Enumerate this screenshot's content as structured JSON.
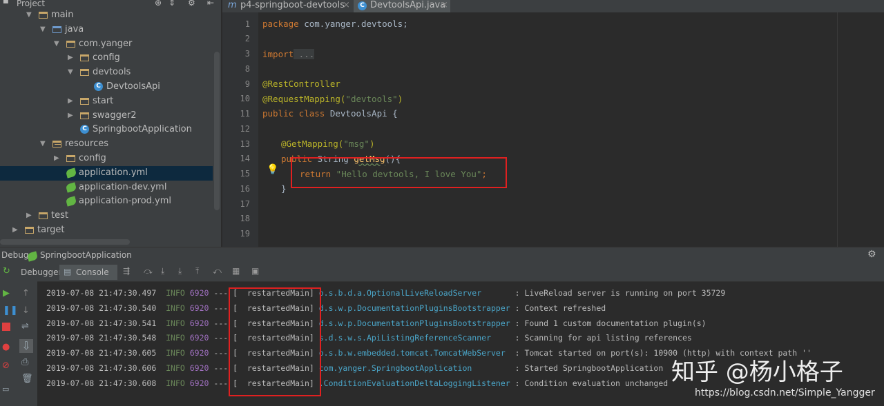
{
  "project_panel": {
    "header": "Project",
    "tree": [
      {
        "label": "main",
        "kind": "folder",
        "arrow": "▼"
      },
      {
        "label": "java",
        "kind": "src",
        "arrow": "▼"
      },
      {
        "label": "com.yanger",
        "kind": "folder",
        "arrow": "▼"
      },
      {
        "label": "config",
        "kind": "folder",
        "arrow": "▶"
      },
      {
        "label": "devtools",
        "kind": "folder",
        "arrow": "▼"
      },
      {
        "label": "DevtoolsApi",
        "kind": "class",
        "arrow": ""
      },
      {
        "label": "start",
        "kind": "folder",
        "arrow": "▶"
      },
      {
        "label": "swagger2",
        "kind": "folder",
        "arrow": "▶"
      },
      {
        "label": "SpringbootApplication",
        "kind": "class",
        "arrow": ""
      },
      {
        "label": "resources",
        "kind": "res",
        "arrow": "▼"
      },
      {
        "label": "config",
        "kind": "folder",
        "arrow": "▶"
      },
      {
        "label": "application.yml",
        "kind": "yml",
        "arrow": "",
        "selected": true
      },
      {
        "label": "application-dev.yml",
        "kind": "yml",
        "arrow": ""
      },
      {
        "label": "application-prod.yml",
        "kind": "yml",
        "arrow": ""
      },
      {
        "label": "test",
        "kind": "folder",
        "arrow": "▶"
      },
      {
        "label": "target",
        "kind": "folder",
        "arrow": "▶"
      }
    ]
  },
  "editor": {
    "tabs": [
      {
        "label": "p4-springboot-devtools",
        "icon": "m"
      },
      {
        "label": "DevtoolsApi.java",
        "icon": "C",
        "active": true
      }
    ],
    "line_numbers": [
      "1",
      "2",
      "3",
      "8",
      "9",
      "10",
      "11",
      "12",
      "13",
      "14",
      "15",
      "16",
      "17",
      "18",
      "19"
    ],
    "code": {
      "l1_kw": "package",
      "l1_rest": " com.yanger.devtools;",
      "l3_kw": "import",
      "l3_rest": " ...",
      "l9": "@RestController",
      "l10_an": "@RequestMapping(",
      "l10_st": "\"devtools\"",
      "l10_end": ")",
      "l11_kw": "public class",
      "l11_rest": " DevtoolsApi {",
      "l13_an": "@GetMapping(",
      "l13_st": "\"msg\"",
      "l13_end": ")",
      "l14_kw": "public",
      "l14_rest": " String ",
      "l14_mt": "getMsg",
      "l14_end": "(){",
      "l15_kw": "return",
      "l15_st": " \"Hello devtools, I love You\"",
      "l15_end": ";",
      "l16": "}"
    }
  },
  "debug": {
    "title": "Debug",
    "config": "SpringbootApplication",
    "tabs": [
      "Debugger",
      "Console"
    ],
    "log": [
      {
        "ts": "2019-07-08 21:47:30.497",
        "level": "INFO",
        "pid": "6920",
        "sep": "---",
        "thread": "[  restartedMain]",
        "logger": "o.s.b.d.a.OptionalLiveReloadServer      ",
        "msg": ": LiveReload server is running on port 35729"
      },
      {
        "ts": "2019-07-08 21:47:30.540",
        "level": "INFO",
        "pid": "6920",
        "sep": "---",
        "thread": "[  restartedMain]",
        "logger": "d.s.w.p.DocumentationPluginsBootstrapper",
        "msg": ": Context refreshed"
      },
      {
        "ts": "2019-07-08 21:47:30.541",
        "level": "INFO",
        "pid": "6920",
        "sep": "---",
        "thread": "[  restartedMain]",
        "logger": "d.s.w.p.DocumentationPluginsBootstrapper",
        "msg": ": Found 1 custom documentation plugin(s)"
      },
      {
        "ts": "2019-07-08 21:47:30.548",
        "level": "INFO",
        "pid": "6920",
        "sep": "---",
        "thread": "[  restartedMain]",
        "logger": "s.d.s.w.s.ApiListingReferenceScanner    ",
        "msg": ": Scanning for api listing references"
      },
      {
        "ts": "2019-07-08 21:47:30.605",
        "level": "INFO",
        "pid": "6920",
        "sep": "---",
        "thread": "[  restartedMain]",
        "logger": "o.s.b.w.embedded.tomcat.TomcatWebServer ",
        "msg": ": Tomcat started on port(s): 10900 (http) with context path ''"
      },
      {
        "ts": "2019-07-08 21:47:30.606",
        "level": "INFO",
        "pid": "6920",
        "sep": "---",
        "thread": "[  restartedMain]",
        "logger": "com.yanger.SpringbootApplication        ",
        "msg": ": Started SpringbootApplication"
      },
      {
        "ts": "2019-07-08 21:47:30.608",
        "level": "INFO",
        "pid": "6920",
        "sep": "---",
        "thread": "[  restartedMain]",
        "logger": ".ConditionEvaluationDeltaLoggingListener",
        "msg": ": Condition evaluation unchanged"
      }
    ]
  },
  "watermark": {
    "text": "知乎 @杨小格子",
    "url": "https://blog.csdn.net/Simple_Yangger"
  },
  "colors": {
    "accent_red": "#e02020",
    "selection": "#0d293e"
  }
}
